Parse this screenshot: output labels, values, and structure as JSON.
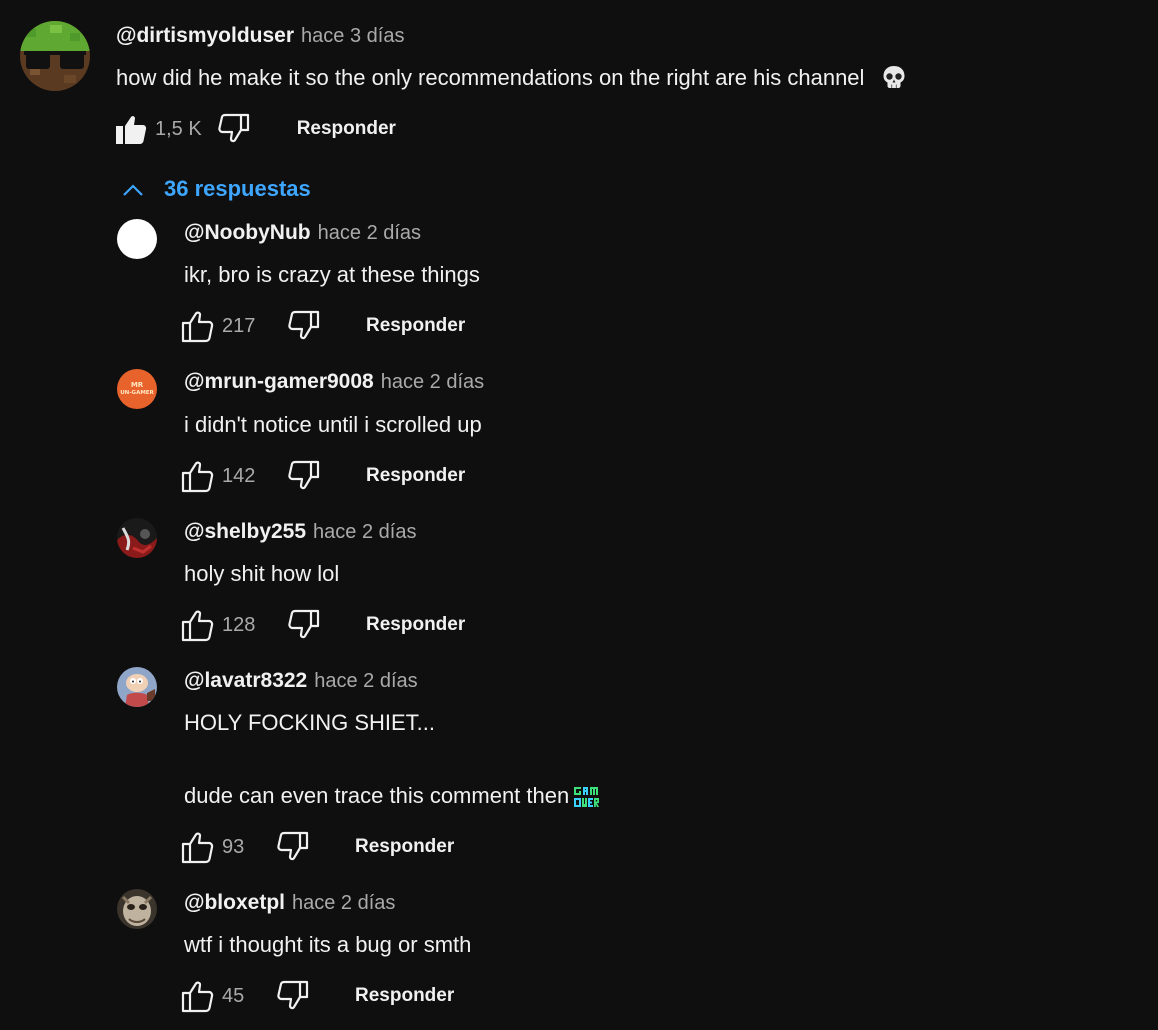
{
  "parent": {
    "handle": "@dirtismyolduser",
    "time": "hace 3 días",
    "text": "how did he make it so the only recommendations on the right are his channel",
    "emoji": "skull-emoji",
    "likes": "1,5 K",
    "liked": true,
    "reply_label": "Responder"
  },
  "replies_toggle": {
    "label": "36 respuestas",
    "icon": "chevron-up-icon",
    "color": "#3ea6ff"
  },
  "replies": [
    {
      "handle": "@NoobyNub",
      "time": "hace 2 días",
      "text": "ikr, bro is crazy at these things",
      "likes": "217",
      "reply_label": "Responder"
    },
    {
      "handle": "@mrun-gamer9008",
      "time": "hace 2 días",
      "text": "i didn't notice until i scrolled up",
      "likes": "142",
      "reply_label": "Responder",
      "avatar_text": "MR UN-GAMER"
    },
    {
      "handle": "@shelby255",
      "time": "hace 2 días",
      "text": "holy shit how lol",
      "likes": "128",
      "reply_label": "Responder"
    },
    {
      "handle": "@lavatr8322",
      "time": "hace 2 días",
      "text_line1": "HOLY FOCKING SHIET...",
      "text_line2": "dude can even trace this comment then",
      "emoji": "game-over-emoji",
      "likes": "93",
      "reply_label": "Responder"
    },
    {
      "handle": "@bloxetpl",
      "time": "hace 2 días",
      "text": "wtf i thought its a bug or smth",
      "likes": "45",
      "reply_label": "Responder"
    }
  ],
  "colors": {
    "background": "#0f0f0f",
    "text": "#f1f1f1",
    "secondary": "#aaaaaa",
    "link": "#3ea6ff"
  }
}
